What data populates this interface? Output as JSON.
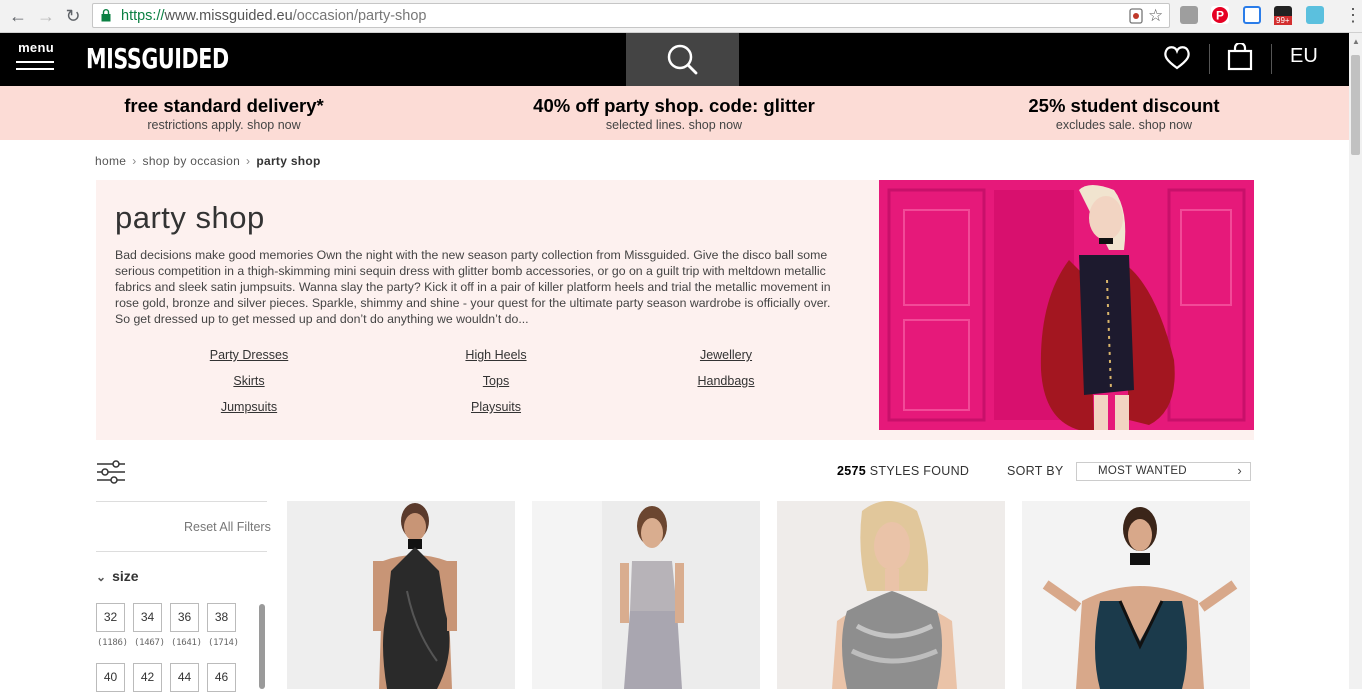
{
  "browser": {
    "url_protocol": "https://",
    "url_domain": "www.missguided.eu",
    "url_path": "/occasion/party-shop",
    "ext_badge": "99+"
  },
  "header": {
    "menu_label": "menu",
    "logo": "MISSGUIDED",
    "region": "EU"
  },
  "promos": [
    {
      "title": "free standard delivery*",
      "subtitle": "restrictions apply. shop now"
    },
    {
      "title": "40% off party shop. code: glitter",
      "subtitle": "selected lines. shop now"
    },
    {
      "title": "25% student discount",
      "subtitle": "excludes sale. shop now"
    }
  ],
  "breadcrumb": {
    "items": [
      "home",
      "shop by occasion"
    ],
    "current": "party shop",
    "separator": "›"
  },
  "hero": {
    "title": "party shop",
    "description": "Bad decisions make good memories Own the night with the new season party collection from Missguided. Give the disco ball some serious competition in a thigh-skimming mini sequin dress with glitter bomb accessories, or go on a guilt trip with meltdown metallic fabrics and sleek satin jumpsuits. Wanna slay the party? Kick it off in a pair of killer platform heels and trial the metallic movement in rose gold, bronze and silver pieces. Sparkle, shimmy and shine - your quest for the ultimate party season wardrobe is officially over. So get dressed up to get messed up and don’t do anything we wouldn’t do...",
    "categories": [
      "Party Dresses",
      "High Heels",
      "Jewellery",
      "Skirts",
      "Tops",
      "Handbags",
      "Jumpsuits",
      "Playsuits"
    ]
  },
  "toolbar": {
    "styles_count": "2575",
    "styles_label": "STYLES FOUND",
    "sort_label": "SORT BY",
    "sort_value": "MOST WANTED"
  },
  "sidebar": {
    "reset_label": "Reset All Filters",
    "size_heading": "size",
    "sizes": [
      {
        "label": "32",
        "count": "(1186)"
      },
      {
        "label": "34",
        "count": "(1467)"
      },
      {
        "label": "36",
        "count": "(1641)"
      },
      {
        "label": "38",
        "count": "(1714)"
      },
      {
        "label": "40",
        "count": ""
      },
      {
        "label": "42",
        "count": ""
      },
      {
        "label": "44",
        "count": ""
      },
      {
        "label": "46",
        "count": ""
      }
    ]
  },
  "colors": {
    "brand_black": "#000000",
    "promo_pink": "#fcdcd6",
    "hero_bg": "#fdf1ef",
    "hero_image_pink": "#e6197a"
  }
}
